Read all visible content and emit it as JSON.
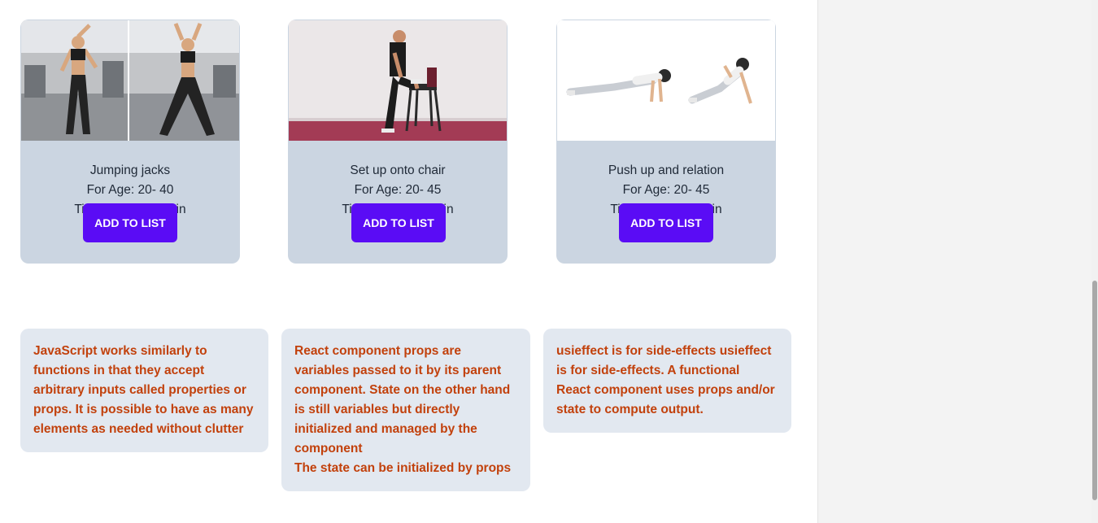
{
  "cards": [
    {
      "name": "Jumping jacks",
      "age": "For Age: 20- 40",
      "time": "Time required: 5min",
      "button": "ADD TO LIST"
    },
    {
      "name": "Set up onto chair",
      "age": "For Age: 20- 45",
      "time": "Time required: 5min",
      "button": "ADD TO LIST"
    },
    {
      "name": "Push up and relation",
      "age": "For Age: 20- 45",
      "time": "Time required: 5min",
      "button": "ADD TO LIST"
    }
  ],
  "notes": [
    {
      "lines": [
        "JavaScript works similarly to",
        "functions in that they accept",
        "arbitrary inputs called properties or",
        "props. It is possible to have as many",
        "elements as needed without clutter"
      ]
    },
    {
      "lines": [
        "React component props are",
        "variables passed to it by its parent",
        "component. State on the other hand",
        "is still variables but directly",
        "initialized and managed by the",
        "component",
        "The state can be initialized by props"
      ]
    },
    {
      "lines": [
        "usieffect is for side-effects usieffect",
        "is for side-effects. A functional",
        "React component uses props and/or",
        "state to compute output."
      ]
    }
  ],
  "colors": {
    "card_bg": "#cbd5e1",
    "note_bg": "#e2e8f0",
    "button_bg": "#5a0cf5",
    "note_text": "#c2410c"
  }
}
